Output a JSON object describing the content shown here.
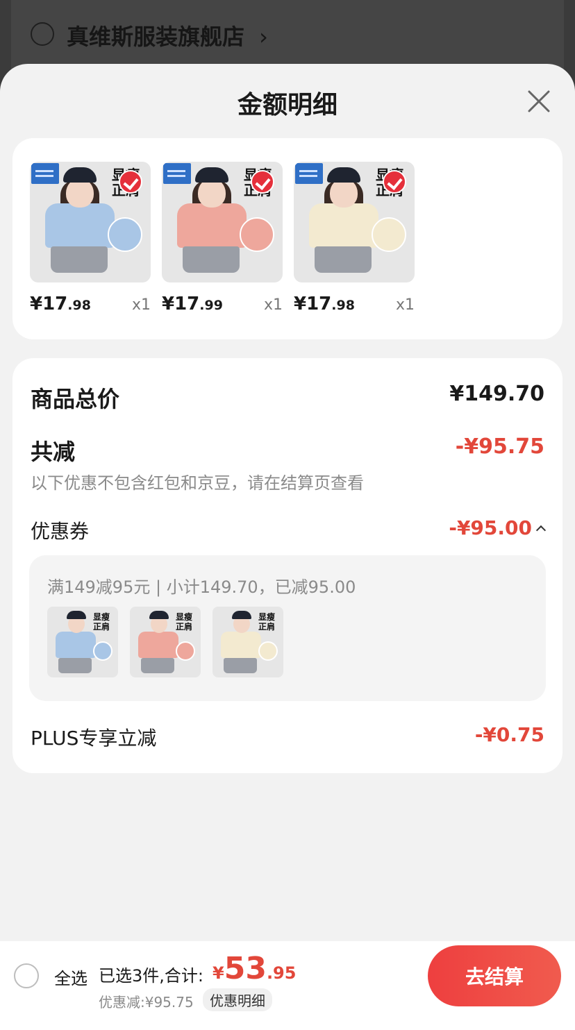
{
  "background": {
    "store_name": "真维斯服装旗舰店",
    "chevron": "›"
  },
  "sheet": {
    "title": "金额明细"
  },
  "products": [
    {
      "tag": "显瘦\n正肩",
      "shirt_color": "#a9c6e6",
      "swatch_color": "#a9c6e6",
      "price_int": "¥17",
      "price_dec": ".98",
      "qty": "x1"
    },
    {
      "tag": "显瘦\n正肩",
      "shirt_color": "#eea79c",
      "swatch_color": "#eea79c",
      "price_int": "¥17",
      "price_dec": ".99",
      "qty": "x1"
    },
    {
      "tag": "显瘦\n正肩",
      "shirt_color": "#f3ead0",
      "swatch_color": "#f3ead0",
      "price_int": "¥17",
      "price_dec": ".98",
      "qty": "x1"
    }
  ],
  "summary": {
    "total_label": "商品总价",
    "total_value": "¥149.70",
    "discount_label": "共减",
    "discount_value": "-¥95.75",
    "note": "以下优惠不包含红包和京豆，请在结算页查看",
    "coupon_label": "优惠券",
    "coupon_value": "-¥95.00",
    "coupon_detail": "满149减95元 | 小计149.70，已减95.00",
    "plus_label": "PLUS专享立减",
    "plus_value": "-¥0.75"
  },
  "bottom_bar": {
    "select_all": "全选",
    "summary": "已选3件,合计:",
    "total_currency": "¥",
    "total_int": "53",
    "total_dec": ".95",
    "discount": "优惠减:¥95.75",
    "detail_link": "优惠明细",
    "checkout": "去结算"
  },
  "colors": {
    "accent_red": "#e2473a",
    "checkout_red": "#ee3f3f"
  }
}
